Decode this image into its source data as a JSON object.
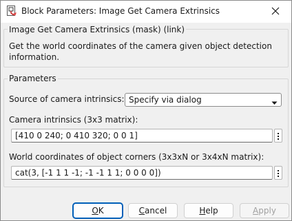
{
  "window": {
    "title": "Block Parameters: Image Get Camera Extrinsics"
  },
  "mask": {
    "title": "Image Get Camera Extrinsics (mask) (link)",
    "description": "Get the world coordinates of the camera given object detection information."
  },
  "parameters": {
    "title": "Parameters",
    "intrinsics_source": {
      "label": "Source of camera intrinsics:",
      "value": "Specify via dialog"
    },
    "camera_intrinsics": {
      "label": "Camera intrinsics (3x3 matrix):",
      "value": "[410 0 240; 0 410 320; 0 0 1]"
    },
    "world_coords": {
      "label": "World coordinates of object corners (3x3xN or 3x4xN matrix):",
      "value": "cat(3, [-1 1 1 -1; -1 -1 1 1; 0 0 0 0])"
    }
  },
  "buttons": {
    "ok": {
      "first": "O",
      "rest": "K"
    },
    "cancel": {
      "first": "C",
      "rest": "ancel"
    },
    "help": {
      "first": "H",
      "rest": "elp"
    },
    "apply": {
      "first": "A",
      "rest": "pply"
    }
  },
  "colors": {
    "accent": "#005fb8",
    "background": "#f0f0f0"
  },
  "icons": {
    "app": "block-parameters-icon",
    "close": "close-icon",
    "dropdown": "chevron-down-icon",
    "more": "vertical-ellipsis-icon"
  }
}
